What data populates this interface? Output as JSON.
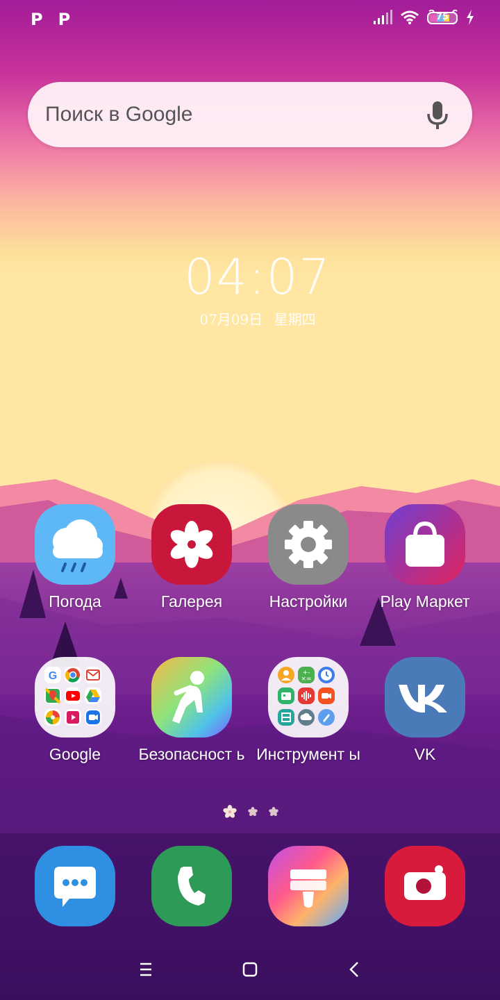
{
  "status_bar": {
    "left_icons": [
      "P",
      "P"
    ],
    "battery_level": "75",
    "icons": [
      "signal-icon",
      "wifi-icon",
      "battery-icon",
      "charging-icon"
    ]
  },
  "search": {
    "placeholder": "Поиск в Google",
    "mic_icon": "mic-icon"
  },
  "clock": {
    "time": "04:07",
    "date": "07月09日 星期四"
  },
  "apps_row1": [
    {
      "label": "Погода",
      "icon": "weather-icon",
      "color": "#5db8f5"
    },
    {
      "label": "Галерея",
      "icon": "gallery-icon",
      "color": "#c8173a"
    },
    {
      "label": "Настройки",
      "icon": "settings-icon",
      "color": "#8a8a8a"
    },
    {
      "label": "Play Маркет",
      "icon": "play-market-icon",
      "color": "#e0245e"
    }
  ],
  "apps_row2": [
    {
      "label": "Google",
      "icon": "google-folder-icon"
    },
    {
      "label": "Безопасност ь",
      "icon": "safety-icon"
    },
    {
      "label": "Инструмент ы",
      "icon": "tools-folder-icon"
    },
    {
      "label": "VK",
      "icon": "vk-icon",
      "color": "#4a7ab8"
    }
  ],
  "dock": [
    {
      "icon": "messages-icon",
      "color": "#2f8fe3"
    },
    {
      "icon": "phone-icon",
      "color": "#2e9a57"
    },
    {
      "icon": "theme-icon"
    },
    {
      "icon": "camera-icon",
      "color": "#d81b3c"
    }
  ],
  "nav": [
    "recents-icon",
    "home-icon",
    "back-icon"
  ]
}
